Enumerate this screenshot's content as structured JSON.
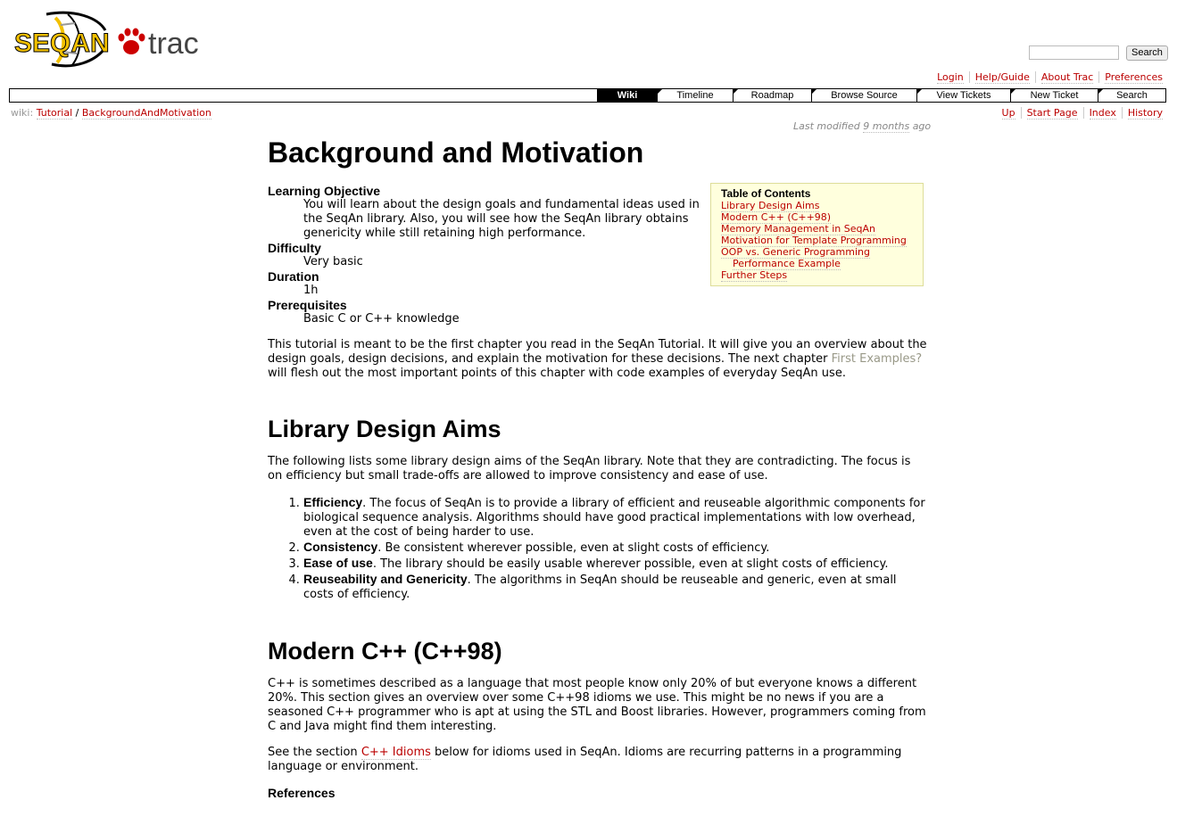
{
  "header": {
    "logo_text_seqan": "SEQAN",
    "logo_text_trac": "trac",
    "search_placeholder": "",
    "search_button": "Search"
  },
  "metanav": [
    "Login",
    "Help/Guide",
    "About Trac",
    "Preferences"
  ],
  "mainnav": [
    "Wiki",
    "Timeline",
    "Roadmap",
    "Browse Source",
    "View Tickets",
    "New Ticket",
    "Search"
  ],
  "ctxtnav": [
    "Up",
    "Start Page",
    "Index",
    "History"
  ],
  "breadcrumb": {
    "prefix": "wiki:",
    "items": [
      "Tutorial",
      "BackgroundAndMotivation"
    ],
    "sep": "/"
  },
  "last_modified": {
    "prefix": "Last modified",
    "age": "9 months",
    "suffix": "ago"
  },
  "page": {
    "title": "Background and Motivation",
    "definitions": [
      {
        "term": "Learning Objective",
        "desc": "You will learn about the design goals and fundamental ideas used in the SeqAn library. Also, you will see how the SeqAn library obtains genericity while still retaining high performance."
      },
      {
        "term": "Difficulty",
        "desc": "Very basic"
      },
      {
        "term": "Duration",
        "desc": "1h"
      },
      {
        "term": "Prerequisites",
        "desc": "Basic C or C++ knowledge"
      }
    ],
    "intro_before": "This tutorial is meant to be the first chapter you read in the SeqAn Tutorial. It will give you an overview about the design goals, design decisions, and explain the motivation for these decisions. The next chapter ",
    "intro_link": "First Examples?",
    "intro_after": " will flesh out the most important points of this chapter with code examples of everyday SeqAn use.",
    "section1_title": "Library Design Aims",
    "section1_text": "The following lists some library design aims of the SeqAn library. Note that they are contradicting. The focus is on efficiency but small trade-offs are allowed to improve consistency and ease of use.",
    "aims": [
      {
        "name": "Efficiency",
        "text": ". The focus of SeqAn is to provide a library of efficient and reuseable algorithmic components for biological sequence analysis. Algorithms should have good practical implementations with low overhead, even at the cost of being harder to use."
      },
      {
        "name": "Consistency",
        "text": ". Be consistent wherever possible, even at slight costs of efficiency."
      },
      {
        "name": "Ease of use",
        "text": ". The library should be easily usable wherever possible, even at slight costs of efficiency."
      },
      {
        "name": "Reuseability and Genericity",
        "text": ". The algorithms in SeqAn should be reuseable and generic, even at small costs of efficiency."
      }
    ],
    "section2_title": "Modern C++ (C++98)",
    "section2_p1": "C++ is sometimes described as a language that most people know only 20% of but everyone knows a different 20%. This section gives an overview over some C++98 idioms we use. This might be no news if you are a seasoned C++ programmer who is apt at using the STL and Boost libraries. However, programmers coming from C and Java might find them interesting.",
    "section2_p2_before": "See the section ",
    "section2_p2_link": "C++ Idioms",
    "section2_p2_after": " below for idioms used in SeqAn. Idioms are recurring patterns in a programming language or environment.",
    "references_label": "References"
  },
  "toc": {
    "title": "Table of Contents",
    "items": [
      "Library Design Aims",
      "Modern C++ (C++98)",
      "Memory Management in SeqAn",
      "Motivation for Template Programming",
      "OOP vs. Generic Programming",
      "Performance Example",
      "Further Steps"
    ]
  },
  "colors": {
    "link": "#bb0000",
    "toc_bg": "#ffffdd",
    "logo_yellow": "#f2c000"
  }
}
